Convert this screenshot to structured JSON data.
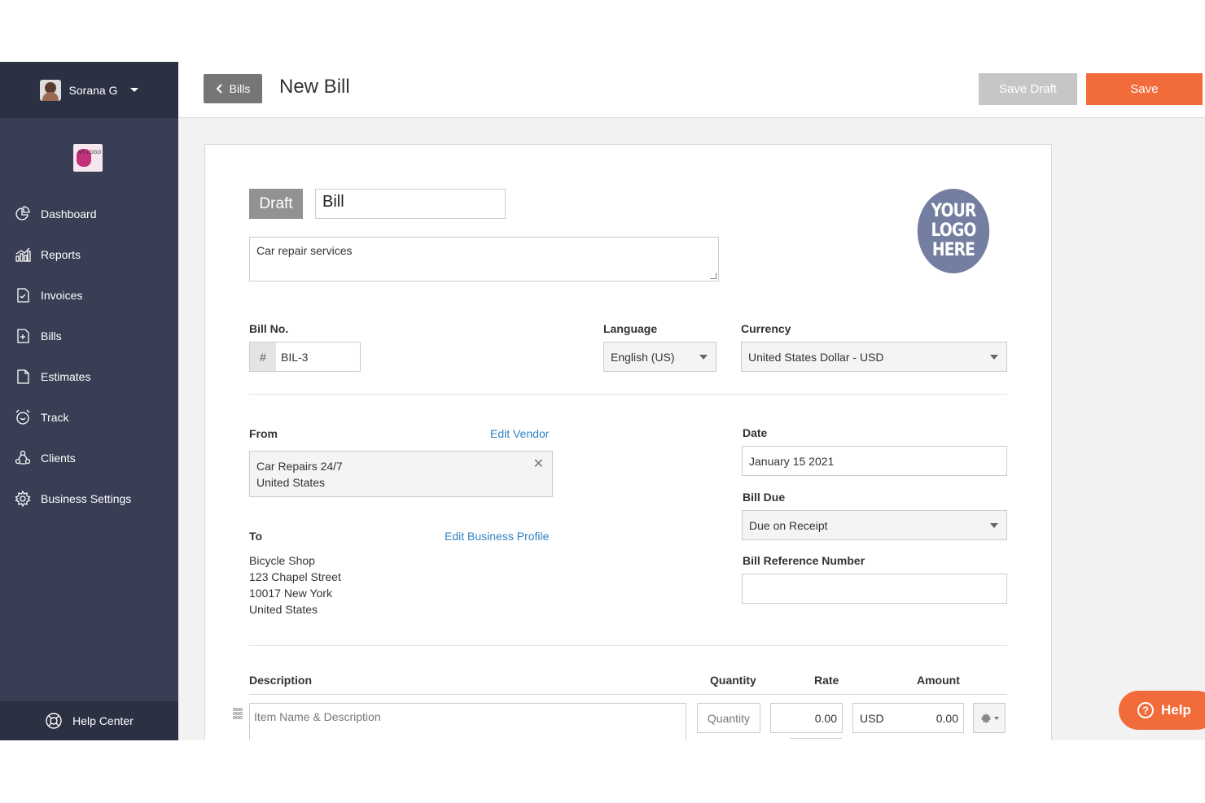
{
  "user": {
    "name": "Sorana G"
  },
  "company_logo": {
    "text": "MY LOGO"
  },
  "sidebar": {
    "items": [
      {
        "label": "Dashboard",
        "icon": "pie-chart-icon"
      },
      {
        "label": "Reports",
        "icon": "bar-chart-icon"
      },
      {
        "label": "Invoices",
        "icon": "invoice-icon"
      },
      {
        "label": "Bills",
        "icon": "bill-icon"
      },
      {
        "label": "Estimates",
        "icon": "document-icon"
      },
      {
        "label": "Track",
        "icon": "alarm-clock-icon"
      },
      {
        "label": "Clients",
        "icon": "clients-icon"
      },
      {
        "label": "Business Settings",
        "icon": "gear-icon"
      }
    ],
    "help_center": "Help Center"
  },
  "header": {
    "back_label": "Bills",
    "title": "New Bill",
    "save_draft_label": "Save Draft",
    "save_label": "Save"
  },
  "form": {
    "status": "Draft",
    "doc_type": "Bill",
    "description": "Car repair services",
    "logo_placeholder": [
      "YOUR",
      "LOGO",
      "HERE"
    ],
    "bill_no": {
      "label": "Bill No.",
      "prefix": "#",
      "value": "BIL-3"
    },
    "language": {
      "label": "Language",
      "value": "English (US)"
    },
    "currency": {
      "label": "Currency",
      "value": "United States Dollar - USD"
    },
    "from": {
      "label": "From",
      "edit_link": "Edit Vendor",
      "vendor_name": "Car Repairs 24/7",
      "vendor_country": "United States"
    },
    "to": {
      "label": "To",
      "edit_link": "Edit Business Profile",
      "lines": [
        "Bicycle Shop",
        "123 Chapel Street",
        "10017 New York",
        "United States"
      ]
    },
    "date": {
      "label": "Date",
      "value": "January 15 2021"
    },
    "bill_due": {
      "label": "Bill Due",
      "value": "Due on Receipt"
    },
    "bill_reference": {
      "label": "Bill Reference Number",
      "value": ""
    },
    "items_table": {
      "headers": {
        "description": "Description",
        "quantity": "Quantity",
        "rate": "Rate",
        "amount": "Amount"
      },
      "row": {
        "description_placeholder": "Item Name & Description",
        "quantity_placeholder": "Quantity",
        "rate": "0.00",
        "currency": "USD",
        "amount": "0.00"
      }
    }
  },
  "help_button": {
    "label": "Help"
  },
  "colors": {
    "accent": "#f26b3a",
    "sidebar": "#383e53",
    "sidebar_dark": "#2b3043",
    "link": "#2f82c4"
  }
}
